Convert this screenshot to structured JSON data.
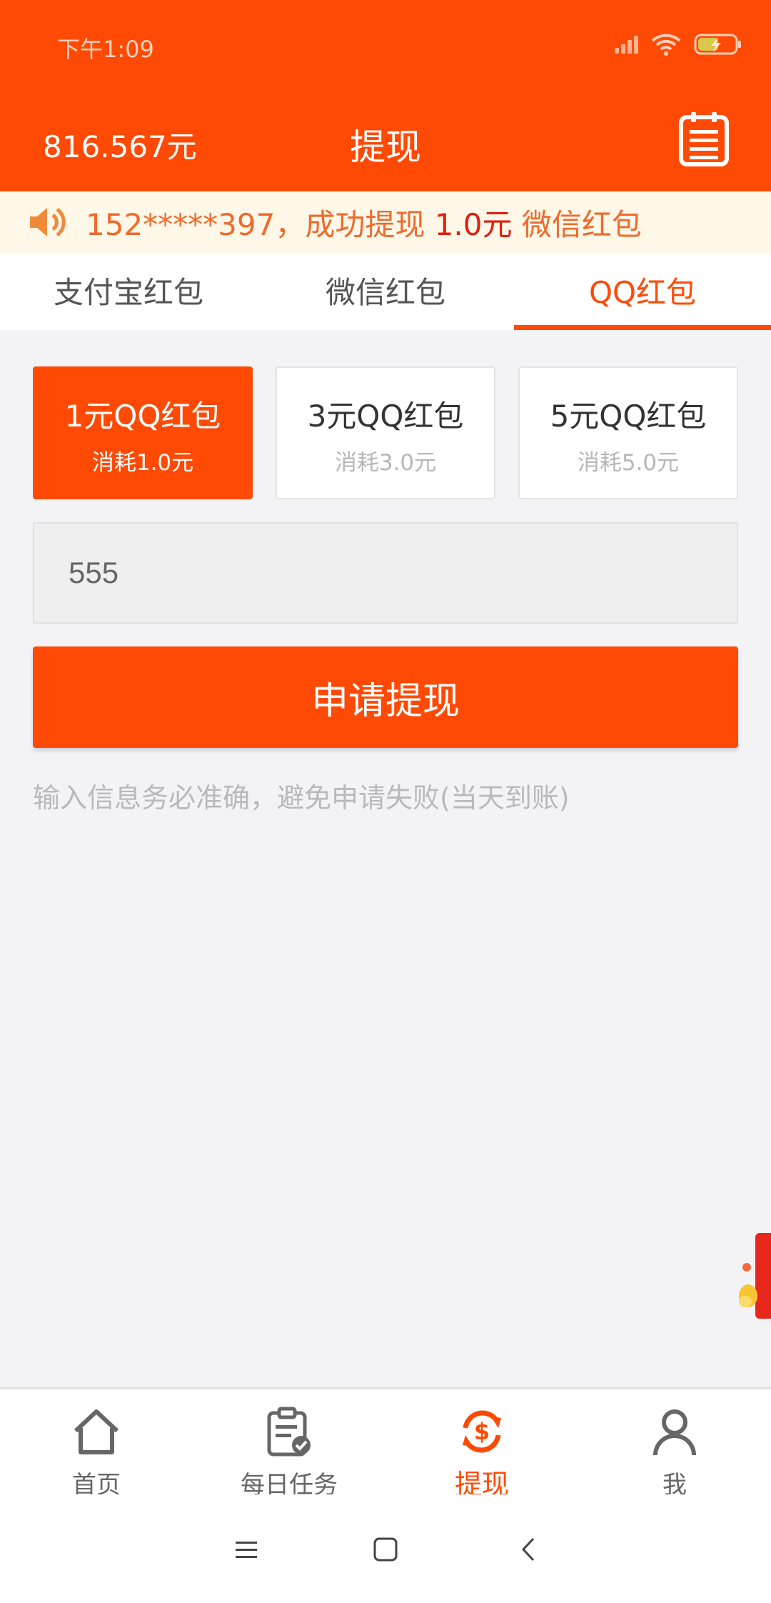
{
  "status_bar": {
    "time": "下午1:09"
  },
  "header": {
    "balance": "816.567元",
    "title": "提现",
    "record_icon": "records-icon"
  },
  "notice": {
    "icon": "speaker-icon",
    "prefix": "152*****397，成功提现 ",
    "amount": "1.0元",
    "suffix": " 微信红包"
  },
  "tabs": [
    {
      "label": "支付宝红包",
      "active": false
    },
    {
      "label": "微信红包",
      "active": false
    },
    {
      "label": "QQ红包",
      "active": true
    }
  ],
  "options": [
    {
      "name": "1元QQ红包",
      "cost": "消耗1.0元",
      "selected": true
    },
    {
      "name": "3元QQ红包",
      "cost": "消耗3.0元",
      "selected": false
    },
    {
      "name": "5元QQ红包",
      "cost": "消耗5.0元",
      "selected": false
    }
  ],
  "account_input": {
    "value": "555"
  },
  "submit": {
    "label": "申请提现"
  },
  "hint": "输入信息务必准确，避免申请失败(当天到账)",
  "bottom_nav": [
    {
      "label": "首页",
      "icon": "home-icon"
    },
    {
      "label": "每日任务",
      "icon": "clipboard-check-icon"
    },
    {
      "label": "提现",
      "icon": "dollar-refresh-icon",
      "active": true
    },
    {
      "label": "我",
      "icon": "person-icon"
    }
  ],
  "colors": {
    "accent": "#ff4a05",
    "notice_bg": "#fff7e7",
    "notice_text": "#ef6a2c",
    "notice_amount": "#e31c0f"
  }
}
